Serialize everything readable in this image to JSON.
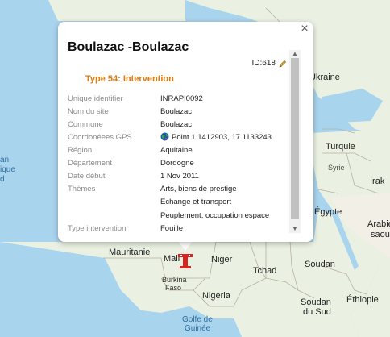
{
  "map": {
    "labels": {
      "ukraine": "Ukraine",
      "turquie": "Turquie",
      "syrie": "Syrie",
      "irak": "Irak",
      "egypte": "Égypte",
      "arabie": "Arabie",
      "arabie2": "saou",
      "mauritanie": "Mauritanie",
      "mali": "Mali",
      "niger": "Niger",
      "tchad": "Tchad",
      "soudan": "Soudan",
      "burkina": "Burkina",
      "burkina2": "Faso",
      "nigeria": "Nigeria",
      "soudan_sud": "Soudan",
      "soudan_sud2": "du Sud",
      "ethiopie": "Éthiopie",
      "golfe": "Golfe de",
      "golfe2": "Guinée",
      "ocean1": "an",
      "ocean2": "ique",
      "ocean3": "d"
    },
    "colors": {
      "sea": "#a9d4ee",
      "land": "#eaf1e2",
      "desert": "#f2efe6"
    }
  },
  "popup": {
    "title": "Boulazac -Boulazac",
    "id_label": "ID:618",
    "type_line": "Type 54: Intervention",
    "close_label": "×",
    "scroll_up": "▲",
    "scroll_down": "▼",
    "fields": [
      {
        "key": "Unique identifier",
        "value": "INRAPI0092"
      },
      {
        "key": "Nom du site",
        "value": "Boulazac"
      },
      {
        "key": "Commune",
        "value": "Boulazac"
      },
      {
        "key": "Coordonéees GPS",
        "value": "Point 1.1412903, 17.1133243"
      },
      {
        "key": "Région",
        "value": "Aquitaine"
      },
      {
        "key": "Département",
        "value": "Dordogne"
      },
      {
        "key": "Date début",
        "value": "1 Nov 2011"
      },
      {
        "key": "Thèmes",
        "values": [
          "Arts, biens de prestige",
          "Échange et transport",
          "Peuplement, occupation espace"
        ]
      },
      {
        "key": "Type intervention",
        "value": "Fouille"
      }
    ]
  }
}
